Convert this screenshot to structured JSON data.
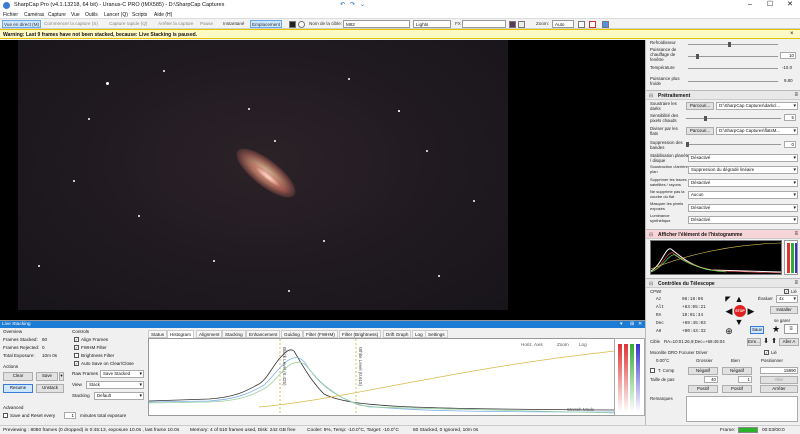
{
  "app": {
    "title": "SharpCap Pro (v4.1.13218, 64 bit) - Uranus-C PRO (IMX585) - D:\\SharpCap Captures",
    "quick_access": [
      "↶",
      "↷",
      "⌄"
    ]
  },
  "menu": [
    "Fichier",
    "Caméras",
    "Capture",
    "Vue",
    "Outils",
    "Lancer (Q)",
    "Scripts",
    "Aide (H)"
  ],
  "toolbar": {
    "live_view": "Vue en direct (M)",
    "start_capture": "Commencer la capture (S)",
    "quick_capture": "Capture rapide (Q)",
    "stop_capture": "Arrêter la capture",
    "pause": "Pause",
    "snapshot": "Instantané",
    "placement": "Emplacement",
    "target_label": "Nom de la cible:",
    "target_value": "M82",
    "lights_value": "Lights",
    "fx_label": "FX",
    "zoom_label": "Zoom:",
    "zoom_value": "Auto"
  },
  "warning": {
    "text": "Warning: Last 9 frames have not been stacked, because: Live Stacking is paused."
  },
  "right_panel": {
    "top_rows": [
      {
        "label": "Refroidisseur",
        "value": ""
      },
      {
        "label": "Puissance de chauffage de fenêtre",
        "value": "10"
      },
      {
        "label": "Température",
        "value": "-10.0"
      },
      {
        "label": "Puissance plus froide",
        "value": "9.80"
      }
    ],
    "pretraitement": {
      "title": "Prétraitement",
      "rows": [
        {
          "label": "Soustraire les darks",
          "button": "Parcouri...",
          "value": "D:\\SharpCap Captures\\darkcl..."
        },
        {
          "label": "Sensibilité des pixels chauds",
          "value": "5"
        },
        {
          "label": "Diviser par les flats",
          "button": "Parcouri...",
          "value": "D:\\SharpCap Captures\\flatsM..."
        },
        {
          "label": "Suppression des bandes",
          "value": "0"
        },
        {
          "label": "Stabilisation planète / disque",
          "value": "Désactivé"
        },
        {
          "label": "Soustraction d'arrière-plan",
          "value": "Suppression du dégradé linéaire"
        },
        {
          "label": "Supprimer les traces satellites / rayons",
          "value": "Désactivé"
        },
        {
          "label": "Ne supprime pas la courbe du flat",
          "value": "Aucun"
        },
        {
          "label": "Masquer les pixels exposés",
          "value": "Désactivé"
        },
        {
          "label": "Luminance synthétique",
          "value": "Désactivé"
        }
      ]
    },
    "histogram_title": "Afficher l'élément de l'histogramme",
    "telescope": {
      "title": "Contrôles du Télescope",
      "driver": "CPWI",
      "connected_label": "Lié",
      "rows": [
        {
          "label": "Az",
          "value": "08:18:06"
        },
        {
          "label": "Alt",
          "value": "+63:05:21"
        },
        {
          "label": "RA",
          "value": "10:01:34"
        },
        {
          "label": "Dec",
          "value": "+69:45:03"
        },
        {
          "label": "AH",
          "value": "+00:43:32"
        }
      ],
      "eval_label": "Évaluer",
      "eval_value": "4x",
      "install_btn": "Installer",
      "park_btn": "se garer",
      "save_btn": "Sauv",
      "stop_btn": "STOP",
      "target_label": "Cible",
      "target_value": "RA=10:01:26,9;Dec=+69:45:04",
      "err_btn": "Erre...",
      "goto_btn": "Aller A"
    },
    "focuser": {
      "title": "Moonlite DRO Focuser Driver",
      "connected_label": "Lié",
      "temp": "0.00°C",
      "coarse_label": "Grossier",
      "fine_label": "Bien",
      "position_label": "Positionner",
      "tcomp_label": "T. Comp",
      "neg_btn": "Négatif",
      "pos_btn": "Positif",
      "step_label": "Taille de pas",
      "coarse_step": "40",
      "fine_step": "1",
      "position_value": "15890",
      "goto_pos": "Aller",
      "stop_btn": "Arrêter"
    },
    "remarks_label": "Remarques"
  },
  "live_stacking": {
    "window_title": "Live Stacking",
    "overview": "Overview",
    "stats": [
      {
        "label": "Frames Stacked:",
        "value": "60"
      },
      {
        "label": "Frames Rejected:",
        "value": "0"
      },
      {
        "label": "Total Exposure:",
        "value": "10m 0s"
      }
    ],
    "actions_label": "Actions",
    "clear_btn": "Clear",
    "save_btn": "Save",
    "resume_btn": "Resume",
    "unstack_btn": "Unstack",
    "advanced_label": "Advanced",
    "save_reset_label": "Save and Reset every",
    "save_reset_value": "1",
    "save_reset_unit": "minutes total exposure",
    "controls_label": "Controls",
    "checkboxes": [
      {
        "label": "Align Frames",
        "checked": true
      },
      {
        "label": "FWHM Filter",
        "checked": true
      },
      {
        "label": "Brightness Filter",
        "checked": false
      },
      {
        "label": "Auto Save on Clear/Close",
        "checked": true
      }
    ],
    "raw_frames_label": "Raw Frames",
    "raw_frames_value": "Save Stacked",
    "view_label": "View",
    "view_value": "Stack",
    "stacking_label": "Stacking",
    "stacking_value": "Default",
    "tabs": [
      "Status",
      "Histogram",
      "Alignment",
      "Stacking",
      "Enhancement",
      "Guiding",
      "Filter (FWHM)",
      "Filter (Brightness)",
      "Drift Graph",
      "Log",
      "Settings"
    ],
    "active_tab": "Histogram",
    "histo_controls": [
      "Horiz. Axis",
      "Zoom",
      "Log"
    ],
    "black_label": "Black Level (0.425)",
    "white_label": "White Level (0.615)",
    "stretch_mode_label": "Stretch Mode"
  },
  "status": {
    "left": "Previewing : 8080 frames (0 dropped) in 0:45:13, exposure 10.0s , last frame 10.0s",
    "memory": "Memory: 4 of 510 frames used, Disk: 242 GB free",
    "cooler": "Cooler: 9%, Temp: -10.0°C, Target: -10.0°C",
    "stacked": "60 Stacked, 0 Ignored, 10m 0s",
    "frame_label": "Frame:",
    "frame_value": "00:03/00:0"
  },
  "colors": {
    "accent": "#1c7cd5",
    "warning_bg": "#fff9c4",
    "stop_red": "#e02020"
  }
}
